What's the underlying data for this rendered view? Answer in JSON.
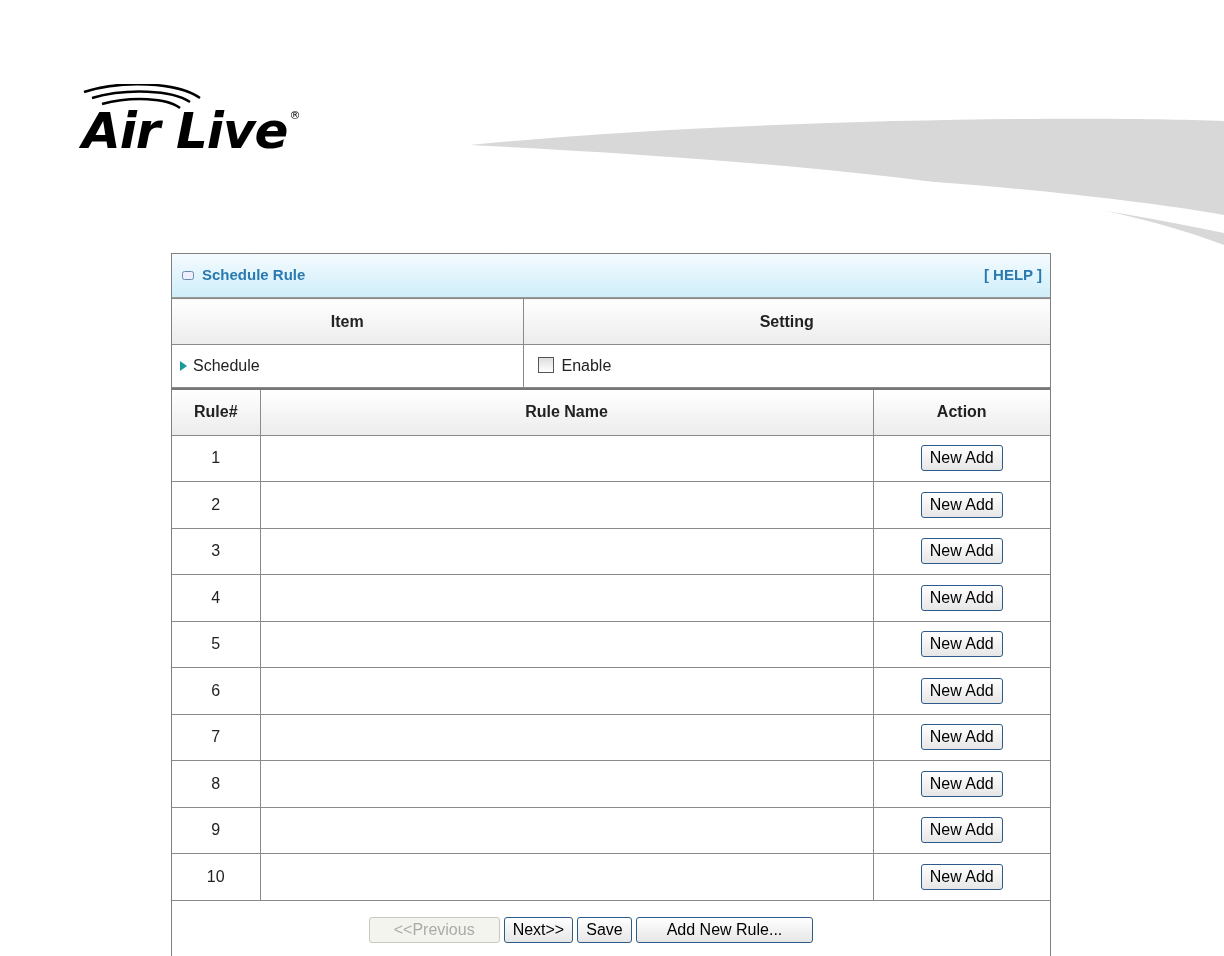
{
  "logo": {
    "text": "Air Live",
    "mark": "®"
  },
  "panel": {
    "title": "Schedule Rule",
    "help": "[ HELP ]",
    "settings_columns": [
      "Item",
      "Setting"
    ],
    "settings": [
      {
        "label": "Schedule",
        "option": "Enable",
        "checked": false
      }
    ],
    "rules_columns": [
      "Rule#",
      "Rule Name",
      "Action"
    ],
    "rules": [
      {
        "number": "1",
        "action": "New Add"
      },
      {
        "number": "2",
        "action": "New Add"
      },
      {
        "number": "3",
        "action": "New Add"
      },
      {
        "number": "4",
        "action": "New Add"
      },
      {
        "number": "5",
        "action": "New Add"
      },
      {
        "number": "6",
        "action": "New Add"
      },
      {
        "number": "7",
        "action": "New Add"
      },
      {
        "number": "8",
        "action": "New Add"
      },
      {
        "number": "9",
        "action": "New Add"
      },
      {
        "number": "10",
        "action": "New Add"
      }
    ],
    "buttons": [
      {
        "label": "<<Previous",
        "disabled": true
      },
      {
        "label": "Next>>",
        "disabled": false
      },
      {
        "label": "Save",
        "disabled": false
      },
      {
        "label": "Add New Rule...",
        "disabled": false
      }
    ]
  }
}
